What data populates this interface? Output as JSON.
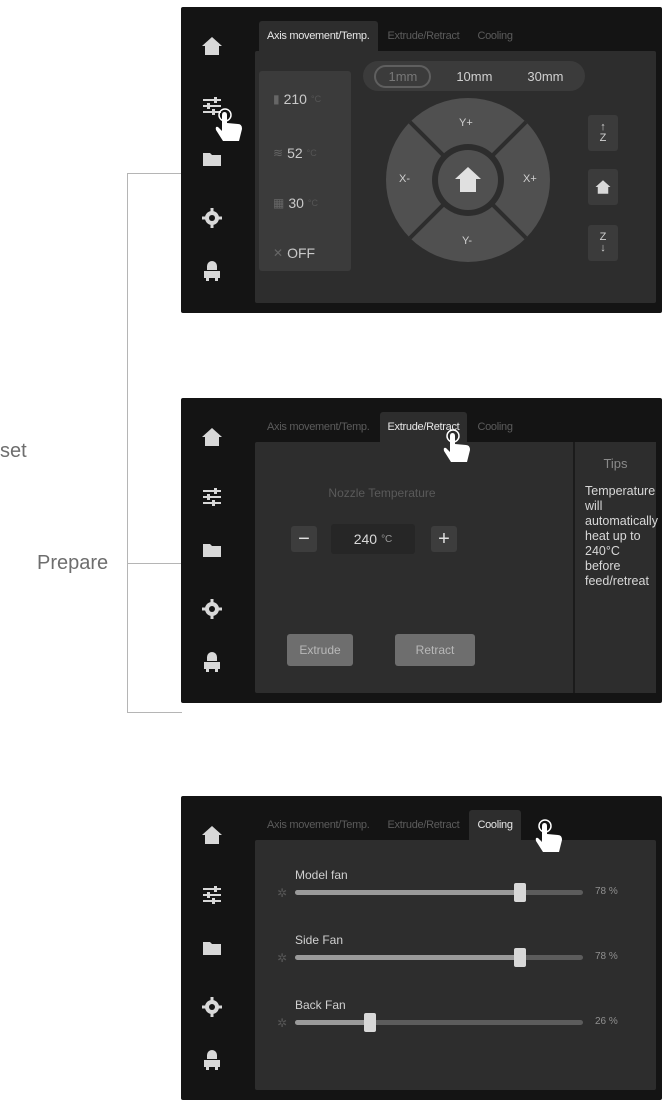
{
  "annotations": {
    "set_label": "set",
    "prepare_label": "Prepare"
  },
  "sidebar_icons": [
    "home-icon",
    "sliders-icon",
    "folder-icon",
    "gear-icon",
    "printer-icon"
  ],
  "tabs": [
    "Axis movement/Temp.",
    "Extrude/Retract",
    "Cooling"
  ],
  "screen1": {
    "nozzle_temp": "210",
    "bed_temp": "52",
    "chamber_temp": "30",
    "fan_state": "OFF",
    "temp_unit": "°C",
    "step_options": [
      "1mm",
      "10mm",
      "30mm"
    ],
    "selected_step": "1mm",
    "joystick": {
      "up": "Y+",
      "down": "Y-",
      "left": "X-",
      "right": "X+"
    },
    "z_up": "Z",
    "z_down": "Z"
  },
  "screen2": {
    "nozzle_temperature_label": "Nozzle Temperature",
    "temp_value": "240",
    "temp_unit": "°C",
    "minus": "−",
    "plus": "+",
    "extrude_label": "Extrude",
    "retract_label": "Retract",
    "tips_title": "Tips",
    "tips_text": "Temperature will automatically heat up to 240°C before feed/retreat"
  },
  "screen3": {
    "fans": [
      {
        "name": "Model fan",
        "percent": 78,
        "percent_label": "78 %"
      },
      {
        "name": "Side Fan",
        "percent": 78,
        "percent_label": "78 %"
      },
      {
        "name": "Back Fan",
        "percent": 26,
        "percent_label": "26 %"
      }
    ]
  },
  "colors": {
    "screen_bg": "#141414",
    "panel_bg": "#2d2d2d",
    "label_gray": "#6e6e6e"
  }
}
